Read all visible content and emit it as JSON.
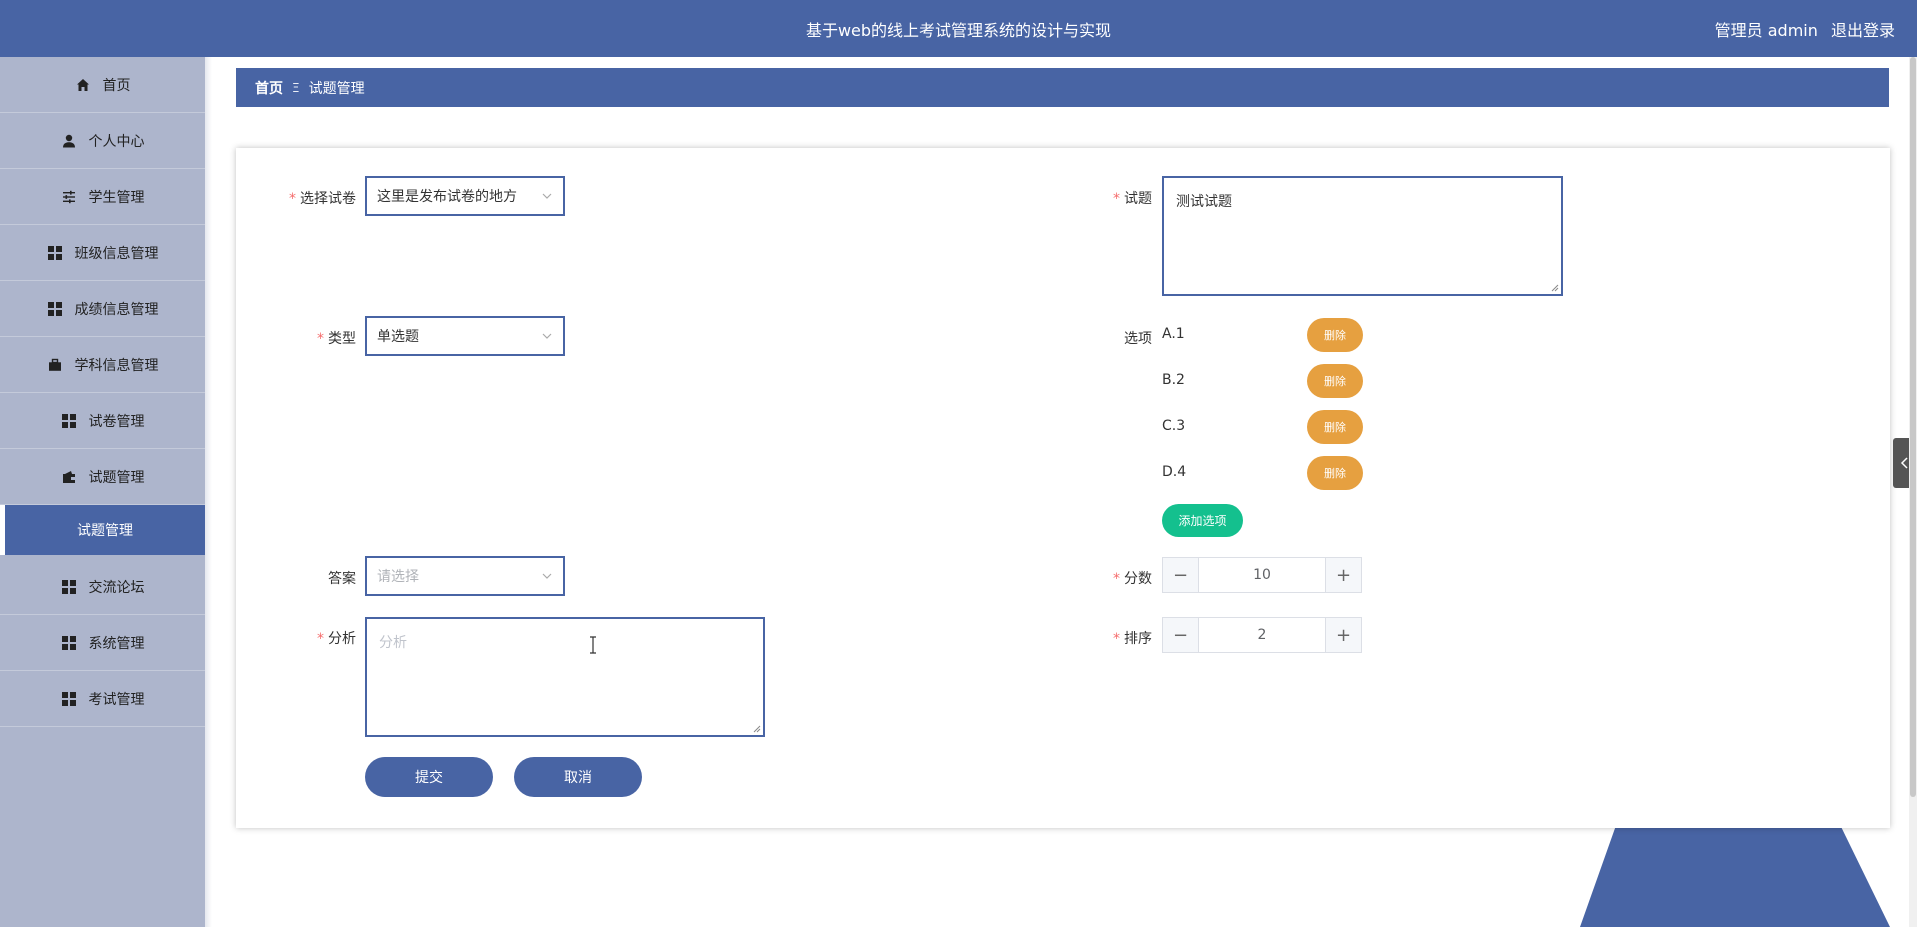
{
  "header": {
    "title": "基于web的线上考试管理系统的设计与实现",
    "user_label": "管理员 admin",
    "logout_label": "退出登录"
  },
  "sidebar": {
    "items": [
      {
        "label": "首页",
        "icon": "home-icon"
      },
      {
        "label": "个人中心",
        "icon": "user-icon"
      },
      {
        "label": "学生管理",
        "icon": "sliders-icon"
      },
      {
        "label": "班级信息管理",
        "icon": "grid-icon"
      },
      {
        "label": "成绩信息管理",
        "icon": "grid-icon"
      },
      {
        "label": "学科信息管理",
        "icon": "briefcase-icon"
      },
      {
        "label": "试卷管理",
        "icon": "grid-icon"
      },
      {
        "label": "试题管理",
        "icon": "wallet-icon"
      }
    ],
    "active_sub": "试题管理",
    "items_after": [
      {
        "label": "交流论坛",
        "icon": "grid-icon"
      },
      {
        "label": "系统管理",
        "icon": "grid-icon"
      },
      {
        "label": "考试管理",
        "icon": "grid-icon"
      }
    ]
  },
  "breadcrumb": {
    "home": "首页",
    "separator": "Ξ",
    "current": "试题管理"
  },
  "form": {
    "paper": {
      "label": "选择试卷",
      "required": "*",
      "value": "这里是发布试卷的地方"
    },
    "type": {
      "label": "类型",
      "required": "*",
      "value": "单选题"
    },
    "answer": {
      "label": "答案",
      "placeholder": "请选择"
    },
    "analysis": {
      "label": "分析",
      "required": "*",
      "placeholder": "分析"
    },
    "question": {
      "label": "试题",
      "required": "*",
      "value": "测试试题"
    },
    "options": {
      "label": "选项",
      "items": [
        "A.1",
        "B.2",
        "C.3",
        "D.4"
      ],
      "delete_label": "删除",
      "add_label": "添加选项"
    },
    "score": {
      "label": "分数",
      "required": "*",
      "value": "10"
    },
    "order": {
      "label": "排序",
      "required": "*",
      "value": "2"
    },
    "submit_label": "提交",
    "cancel_label": "取消"
  },
  "colors": {
    "primary": "#4864a4",
    "sidebar_bg": "#adb5cc",
    "delete": "#e6a040",
    "add": "#14c08e",
    "required": "#f56c6c"
  }
}
